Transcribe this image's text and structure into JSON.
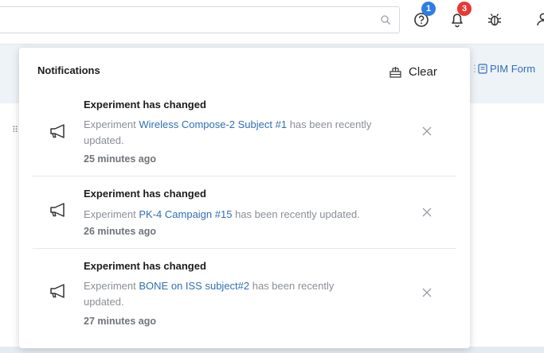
{
  "header": {
    "search_placeholder": "",
    "help_badge": "1",
    "notifications_badge": "3",
    "colors": {
      "help_badge": "#2f7de1",
      "notification_badge": "#e53935"
    }
  },
  "background": {
    "pim_link": "PIM Form"
  },
  "notifications": {
    "title": "Notifications",
    "clear_label": "Clear",
    "items": [
      {
        "title": "Experiment has changed",
        "prefix": "Experiment ",
        "link": "Wireless Compose-2 Subject #1",
        "suffix": " has been recently updated.",
        "time": "25 minutes ago"
      },
      {
        "title": "Experiment has changed",
        "prefix": "Experiment ",
        "link": "PK-4 Campaign #15",
        "suffix": " has been recently updated.",
        "time": "26 minutes ago"
      },
      {
        "title": "Experiment has changed",
        "prefix": "Experiment ",
        "link": "BONE on ISS subject#2",
        "suffix": " has been recently updated.",
        "time": "27 minutes ago"
      }
    ]
  },
  "icons": [
    "search-icon",
    "help-icon",
    "bell-icon",
    "bug-icon",
    "user-icon",
    "megaphone-icon",
    "close-icon",
    "clear-icon",
    "form-icon",
    "drag-handle-icon"
  ]
}
